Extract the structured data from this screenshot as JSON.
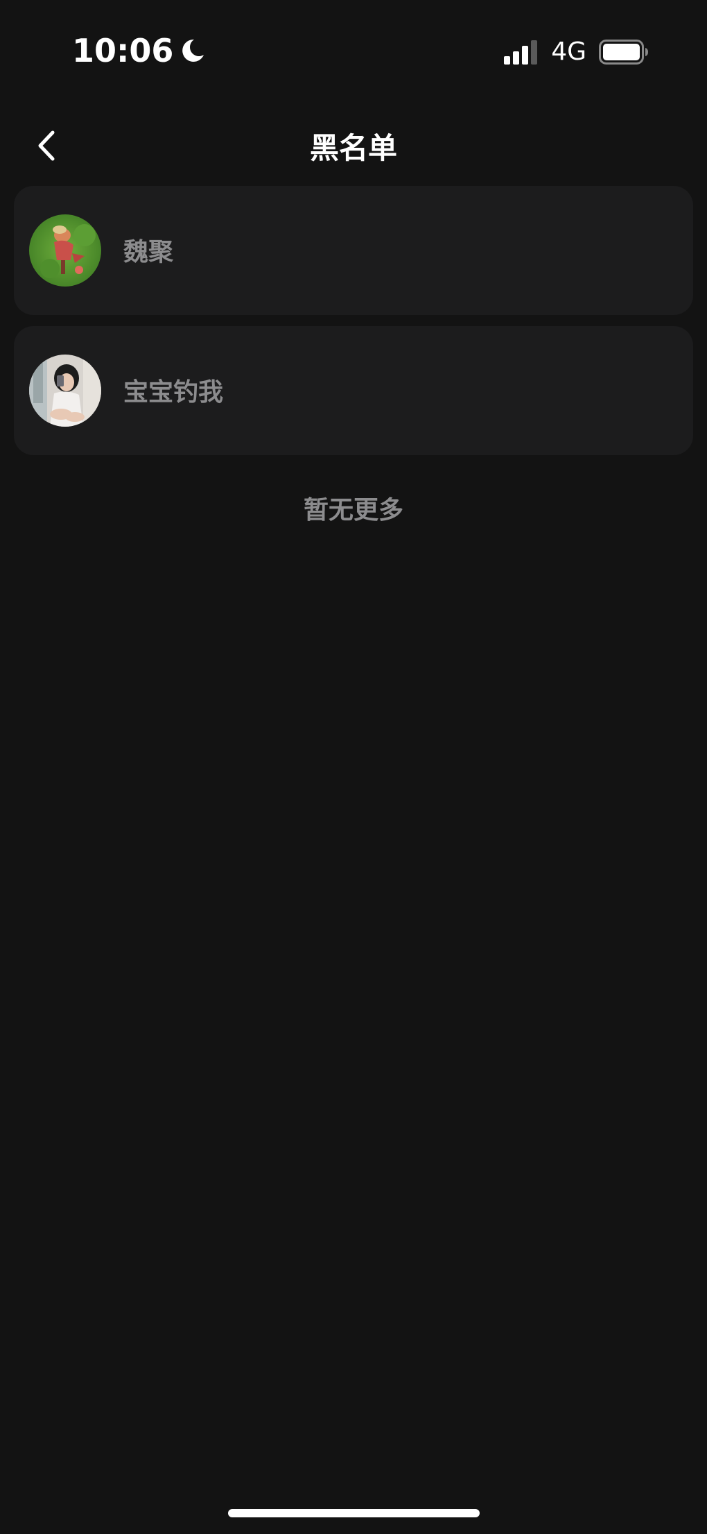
{
  "status_bar": {
    "time": "10:06",
    "network": "4G",
    "icons": [
      "moon-icon",
      "signal-icon",
      "battery-icon"
    ]
  },
  "nav": {
    "title": "黑名单",
    "back_icon": "chevron-left-icon"
  },
  "blocked_users": [
    {
      "name": "魏聚",
      "avatar": "avatar-green-game-character"
    },
    {
      "name": "宝宝钓我",
      "avatar": "avatar-selfie-photo"
    }
  ],
  "footer_text": "暂无更多",
  "colors": {
    "background": "#131313",
    "card": "#1c1c1d",
    "secondary_text": "#8c8c8e",
    "primary_text": "#ffffff"
  }
}
